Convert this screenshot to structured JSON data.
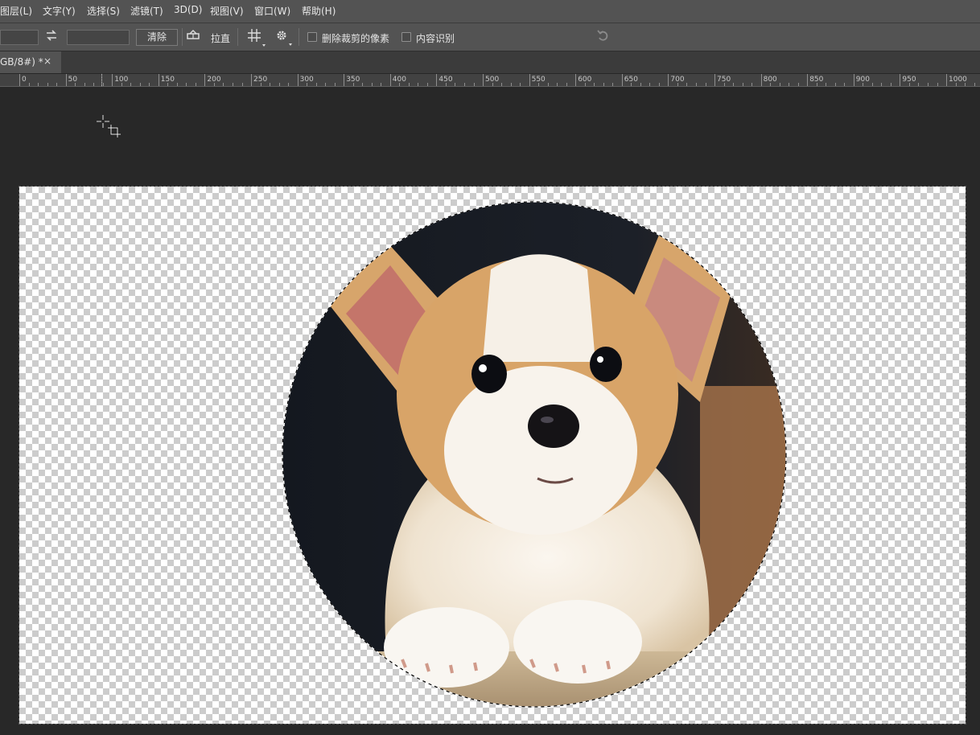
{
  "menu": {
    "items": [
      "图层(L)",
      "文字(Y)",
      "选择(S)",
      "滤镜(T)",
      "3D(D)",
      "视图(V)",
      "窗口(W)",
      "帮助(H)"
    ]
  },
  "options": {
    "clear_label": "清除",
    "straighten_label": "拉直",
    "delete_cropped_label": "删除裁剪的像素",
    "content_aware_label": "内容识别",
    "swap_icon": "swap-arrows-icon",
    "level_icon": "level-icon",
    "grid_icon": "grid-overlay-icon",
    "gear_icon": "gear-icon",
    "reset_icon": "undo-icon"
  },
  "document": {
    "tab_label": "GB/8#) *",
    "close_glyph": "×"
  },
  "ruler": {
    "labels": [
      "0",
      "50",
      "100",
      "150",
      "200",
      "250",
      "300",
      "350",
      "400",
      "450",
      "500",
      "550",
      "600",
      "650",
      "700",
      "750",
      "800",
      "850",
      "900",
      "950",
      "1000"
    ]
  },
  "colors": {
    "menubar": "#535353",
    "workspace": "#282828",
    "accent_text": "#e6e6e6"
  }
}
